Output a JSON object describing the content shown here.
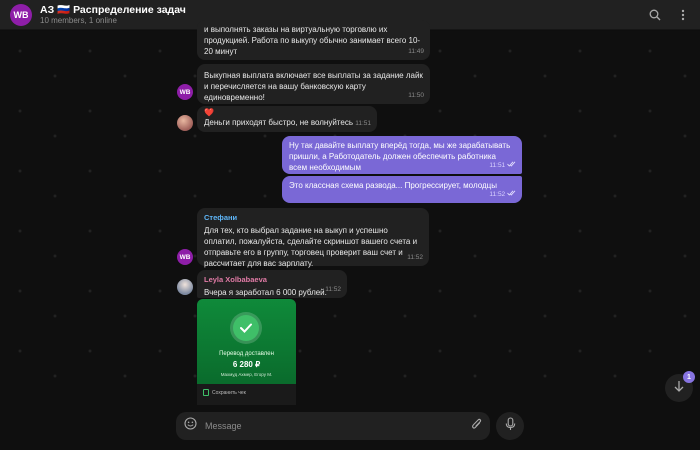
{
  "header": {
    "avatar_text": "WB",
    "title": "АЗ 🇷🇺 Распределение задач",
    "subtitle": "10 members, 1 online"
  },
  "messages": [
    {
      "text": "и выполнять заказы на виртуальную торговлю их продукцией. Работа по выкупу обычно занимает всего 10-20 минут",
      "time": "11:49"
    },
    {
      "text": "Выкупная выплата включает все выплаты за задание лайк  и перечисляется на вашу банковскую карту единовременно!",
      "time": "11:50",
      "avatar": "WB"
    },
    {
      "emoji": "❤️",
      "text": "Деньги приходят быстро, не волнуйтесь",
      "time": "11:51"
    },
    {
      "text": "Ну так давайте выплату вперёд тогда, мы же зарабатывать пришли, а Работодатель должен обеспечить работника всем необходимым",
      "time": "11:51",
      "outgoing": true
    },
    {
      "text": "Это классная схема развода... Прогрессирует, молодцы",
      "time": "11:52",
      "outgoing": true
    },
    {
      "sender": "Стефани",
      "text": "Для тех, кто выбрал задание на выкуп и успешно оплатил, пожалуйста, сделайте скриншот вашего счета и отправьте его в группу, торговец проверит ваш счет и рассчитает для вас зарплату.",
      "time": "11:52",
      "avatar": "WB"
    },
    {
      "sender": "Leyla Xolbabaeva",
      "text": "Вчера я заработал 6 000 рублей.",
      "time": "11:52"
    }
  ],
  "receipt": {
    "status": "Перевод доставлен",
    "amount": "6 280 ₽",
    "recipient": "Махмуд Ахмер, Егору М.",
    "save": "Сохранить чек"
  },
  "scroll_badge": "1",
  "composer": {
    "placeholder": "Message"
  },
  "colors": {
    "accent": "#8774e1",
    "outgoing_bubble": "#7a68d6",
    "incoming_bubble": "#212121",
    "sender_stefani": "#5eb5f7",
    "sender_leyla": "#e17ba6"
  },
  "icons": [
    "search-icon",
    "more-icon",
    "emoji-icon",
    "attach-icon",
    "mic-icon",
    "arrow-down-icon",
    "check-icon",
    "double-check-icon"
  ]
}
